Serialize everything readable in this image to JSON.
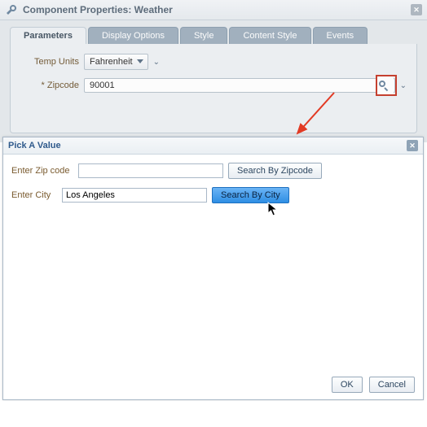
{
  "header": {
    "title": "Component Properties: Weather"
  },
  "tabs": {
    "parameters": "Parameters",
    "display_options": "Display Options",
    "style": "Style",
    "content_style": "Content Style",
    "events": "Events"
  },
  "params": {
    "temp_units_label": "Temp Units",
    "temp_units_value": "Fahrenheit",
    "zipcode_label": "* Zipcode",
    "zipcode_value": "90001"
  },
  "dialog": {
    "title": "Pick A Value",
    "enter_zip_label": "Enter Zip code",
    "enter_zip_value": "",
    "search_by_zip": "Search By Zipcode",
    "enter_city_label": "Enter City",
    "enter_city_value": "Los Angeles",
    "search_by_city": "Search By City",
    "ok": "OK",
    "cancel": "Cancel"
  }
}
